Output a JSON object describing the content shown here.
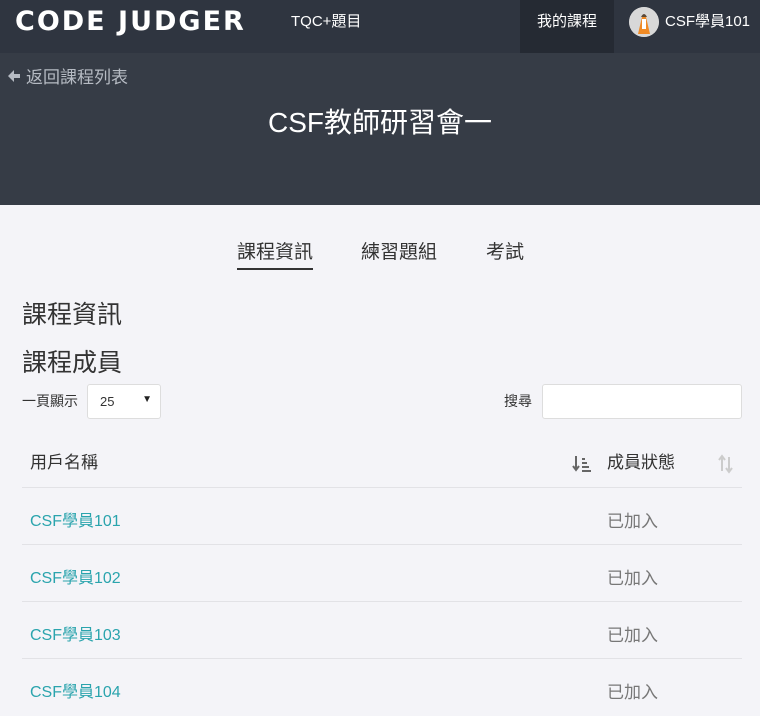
{
  "navbar": {
    "brand": "CODE JUDGER",
    "course_link": "TQC+題目",
    "my_courses": "我的課程",
    "user_name": "CSF學員101"
  },
  "hero": {
    "back_link": "返回課程列表",
    "course_title": "CSF教師研習會一"
  },
  "tabs": [
    {
      "label": "課程資訊",
      "active": true
    },
    {
      "label": "練習題組",
      "active": false
    },
    {
      "label": "考試",
      "active": false
    }
  ],
  "sections": {
    "info_heading": "課程資訊",
    "members_heading": "課程成員"
  },
  "table_controls": {
    "per_page_label": "一頁顯示",
    "per_page_value": "25",
    "search_label": "搜尋",
    "search_value": ""
  },
  "table": {
    "columns": [
      "用戶名稱",
      "成員狀態"
    ],
    "rows": [
      {
        "name": "CSF學員101",
        "status": "已加入"
      },
      {
        "name": "CSF學員102",
        "status": "已加入"
      },
      {
        "name": "CSF學員103",
        "status": "已加入"
      },
      {
        "name": "CSF學員104",
        "status": "已加入"
      }
    ]
  },
  "colors": {
    "navbar": "#2f3540",
    "hero": "#363c46",
    "link": "#2aa4ad"
  },
  "icons": {
    "back": "arrow-left-icon",
    "sort_active": "sort-amount-down-icon",
    "sort_neutral": "sort-icon"
  }
}
